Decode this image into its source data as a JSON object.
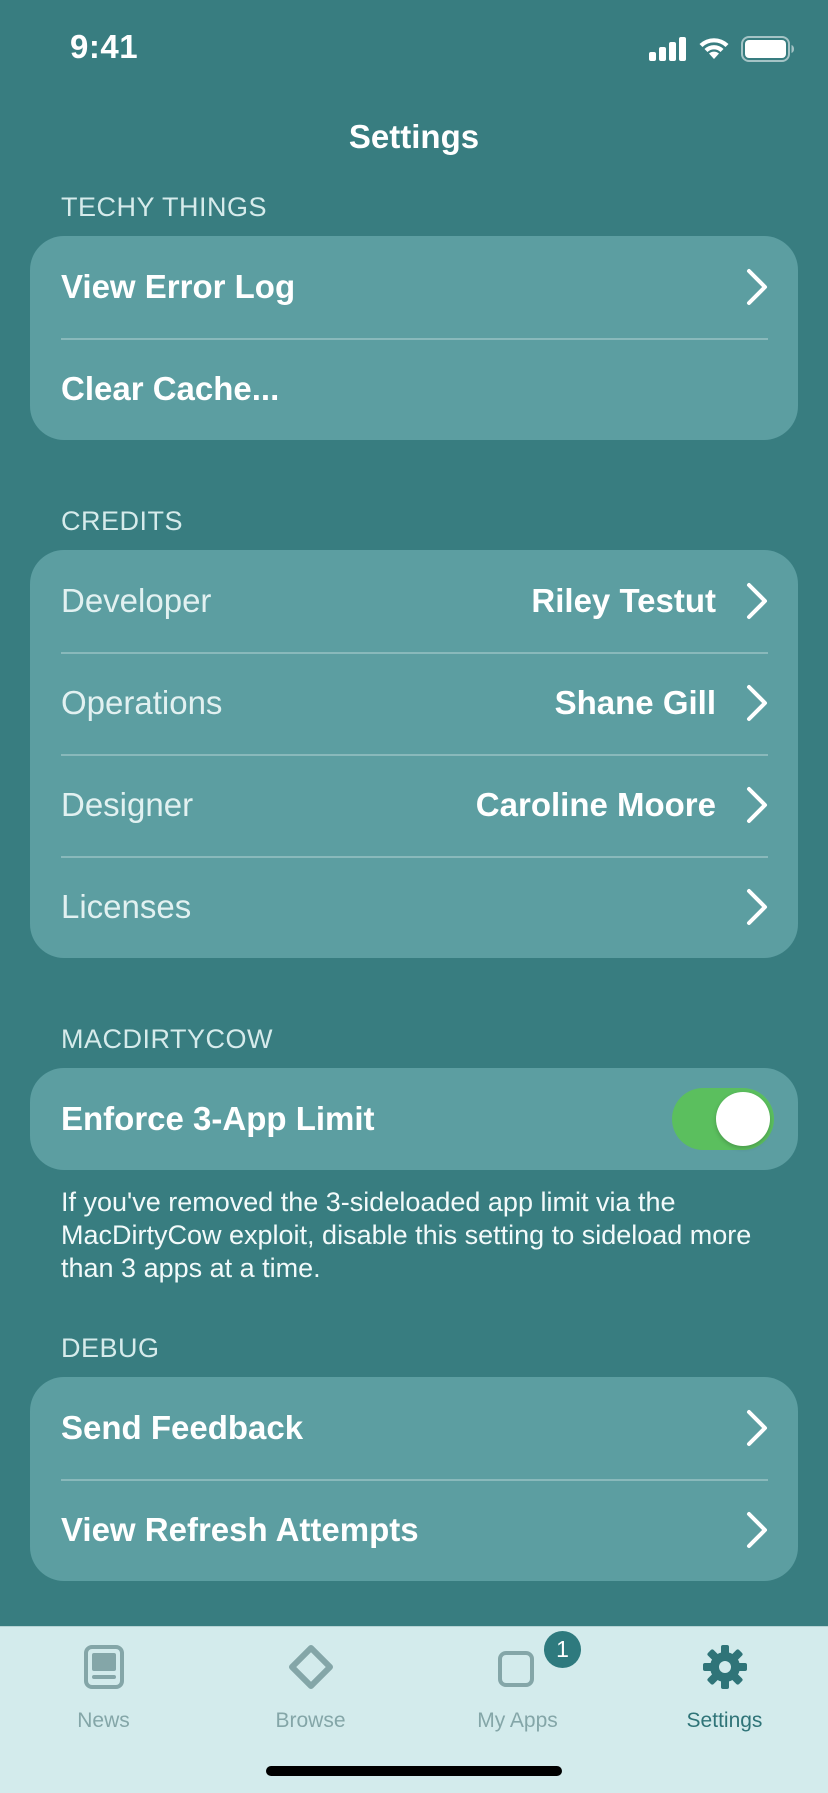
{
  "status_bar": {
    "time": "9:41"
  },
  "nav": {
    "title": "Settings"
  },
  "sections": {
    "techy": {
      "header": "TECHY THINGS",
      "view_error_log": "View Error Log",
      "clear_cache": "Clear Cache..."
    },
    "credits": {
      "header": "CREDITS",
      "developer_label": "Developer",
      "developer_value": "Riley Testut",
      "operations_label": "Operations",
      "operations_value": "Shane Gill",
      "designer_label": "Designer",
      "designer_value": "Caroline Moore",
      "licenses_label": "Licenses"
    },
    "macdirtycow": {
      "header": "MACDIRTYCOW",
      "enforce_label": "Enforce 3-App Limit",
      "enforce_on": true,
      "footer": "If you've removed the 3-sideloaded app limit via the MacDirtyCow exploit, disable this setting to sideload more than 3 apps at a time."
    },
    "debug": {
      "header": "DEBUG",
      "send_feedback": "Send Feedback",
      "view_refresh_attempts": "View Refresh Attempts"
    }
  },
  "tab_bar": {
    "news": "News",
    "browse": "Browse",
    "my_apps": "My Apps",
    "my_apps_badge": "1",
    "settings": "Settings",
    "active_tab": "settings"
  },
  "colors": {
    "background": "#387d80",
    "group": "#5c9ea1",
    "toggle_on": "#5bbf5e",
    "tab_bar": "#d3ebec",
    "tab_inactive": "#84a6a8",
    "tab_active": "#2f7478"
  },
  "icons": {
    "signal": "cellular-signal-icon",
    "wifi": "wifi-icon",
    "battery": "battery-icon",
    "chevron": "chevron-right-icon",
    "news": "news-icon",
    "browse": "browse-icon",
    "my_apps": "my-apps-icon",
    "settings": "gear-icon"
  }
}
